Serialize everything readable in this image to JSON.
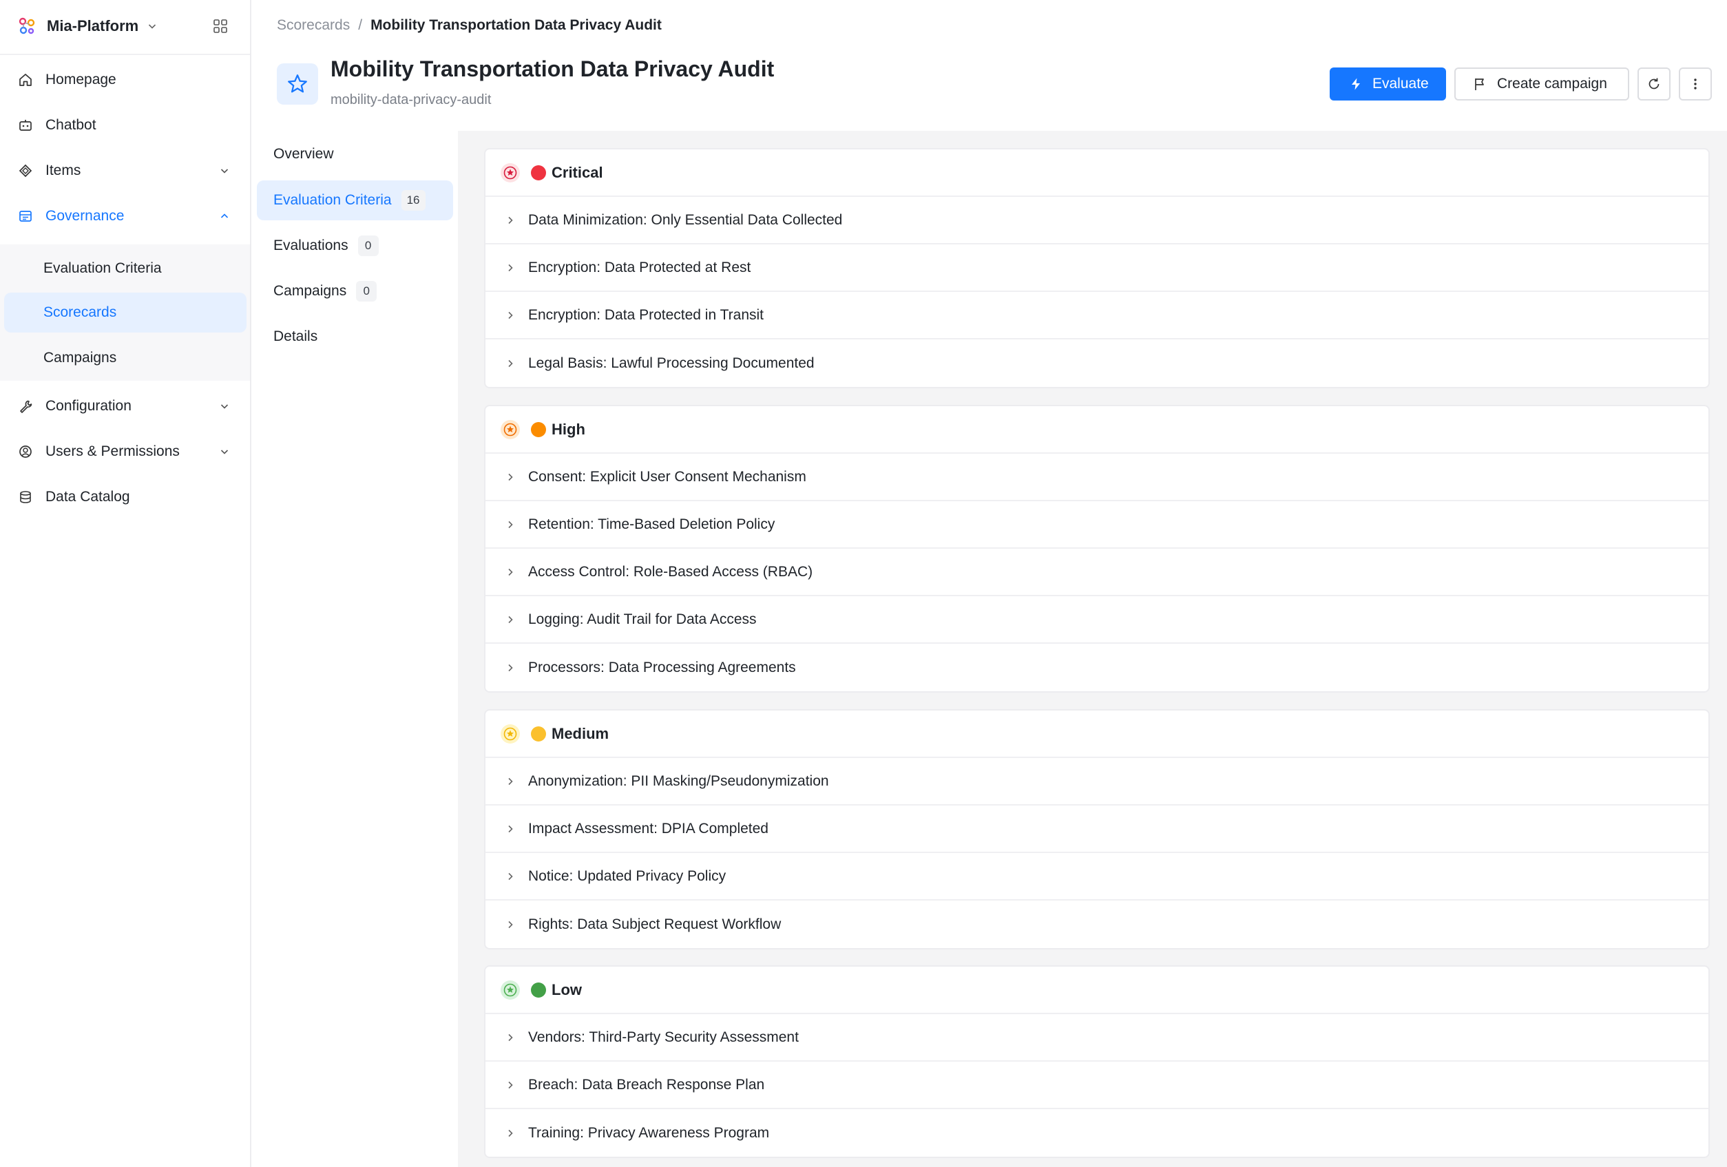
{
  "app": {
    "name": "Mia-Platform",
    "colors": {
      "accent": "#1677ff",
      "critical": "#ef3340",
      "high": "#fb8c00",
      "medium": "#fbc02d",
      "low": "#43a047"
    }
  },
  "sidebar": {
    "items": [
      {
        "label": "Homepage",
        "icon": "home-icon"
      },
      {
        "label": "Chatbot",
        "icon": "chatbot-icon"
      },
      {
        "label": "Items",
        "icon": "items-icon"
      },
      {
        "label": "Governance",
        "icon": "governance-icon"
      },
      {
        "label": "Configuration",
        "icon": "wrench-icon"
      },
      {
        "label": "Users & Permissions",
        "icon": "users-icon"
      },
      {
        "label": "Data Catalog",
        "icon": "database-icon"
      }
    ],
    "governance_children": [
      {
        "label": "Evaluation Criteria"
      },
      {
        "label": "Scorecards"
      },
      {
        "label": "Campaigns"
      }
    ]
  },
  "breadcrumb": {
    "parent": "Scorecards",
    "separator": "/",
    "current": "Mobility Transportation Data Privacy Audit"
  },
  "header": {
    "title": "Mobility Transportation Data Privacy Audit",
    "slug": "mobility-data-privacy-audit",
    "evaluate_label": "Evaluate",
    "create_campaign_label": "Create campaign"
  },
  "subnav": {
    "items": [
      {
        "label": "Overview"
      },
      {
        "label": "Evaluation Criteria",
        "count": "16"
      },
      {
        "label": "Evaluations",
        "count": "0"
      },
      {
        "label": "Campaigns",
        "count": "0"
      },
      {
        "label": "Details"
      }
    ]
  },
  "groups": [
    {
      "label": "Critical",
      "color": "#ef3340",
      "criteria": [
        "Data Minimization: Only Essential Data Collected",
        "Encryption: Data Protected at Rest",
        "Encryption: Data Protected in Transit",
        "Legal Basis: Lawful Processing Documented"
      ]
    },
    {
      "label": "High",
      "color": "#fb8c00",
      "criteria": [
        "Consent: Explicit User Consent Mechanism",
        "Retention: Time-Based Deletion Policy",
        "Access Control: Role-Based Access (RBAC)",
        "Logging: Audit Trail for Data Access",
        "Processors: Data Processing Agreements"
      ]
    },
    {
      "label": "Medium",
      "color": "#fbc02d",
      "criteria": [
        "Anonymization: PII Masking/Pseudonymization",
        "Impact Assessment: DPIA Completed",
        "Notice: Updated Privacy Policy",
        "Rights: Data Subject Request Workflow"
      ]
    },
    {
      "label": "Low",
      "color": "#43a047",
      "criteria": [
        "Vendors: Third-Party Security Assessment",
        "Breach: Data Breach Response Plan",
        "Training: Privacy Awareness Program"
      ]
    }
  ]
}
